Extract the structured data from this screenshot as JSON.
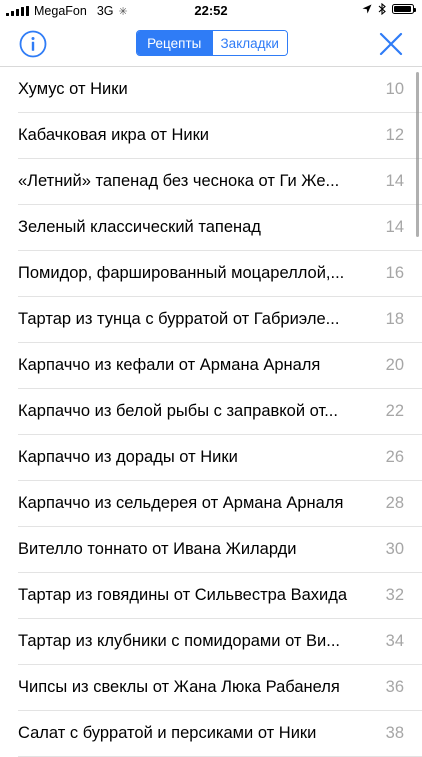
{
  "status_bar": {
    "carrier": "MegaFon",
    "network": "3G",
    "time": "22:52"
  },
  "nav": {
    "segments": [
      {
        "label": "Рецепты",
        "selected": true
      },
      {
        "label": "Закладки",
        "selected": false
      }
    ],
    "accent_color": "#2f7cf6"
  },
  "recipes": [
    {
      "title": "Хумус от Ники",
      "page": "10"
    },
    {
      "title": "Кабачковая икра от Ники",
      "page": "12"
    },
    {
      "title": "«Летний» тапенад без чеснока от Ги Же...",
      "page": "14"
    },
    {
      "title": "Зеленый классический тапенад",
      "page": "14"
    },
    {
      "title": "Помидор, фаршированный моцареллой,...",
      "page": "16"
    },
    {
      "title": "Тартар из тунца с бурратой от Габриэле...",
      "page": "18"
    },
    {
      "title": "Карпаччо из кефали от Армана Арналя",
      "page": "20"
    },
    {
      "title": "Карпаччо из белой рыбы с заправкой от...",
      "page": "22"
    },
    {
      "title": "Карпаччо из дорады от Ники",
      "page": "26"
    },
    {
      "title": "Карпаччо из сельдерея от Армана Арналя",
      "page": "28"
    },
    {
      "title": "Вителло тоннато от Ивана Жиларди",
      "page": "30"
    },
    {
      "title": "Тартар из говядины от Сильвестра Вахида",
      "page": "32"
    },
    {
      "title": "Тартар из клубники с помидорами от Ви...",
      "page": "34"
    },
    {
      "title": "Чипсы из свеклы от Жана Люка Рабанеля",
      "page": "36"
    },
    {
      "title": "Салат с бурратой и персиками от Ники",
      "page": "38"
    }
  ]
}
